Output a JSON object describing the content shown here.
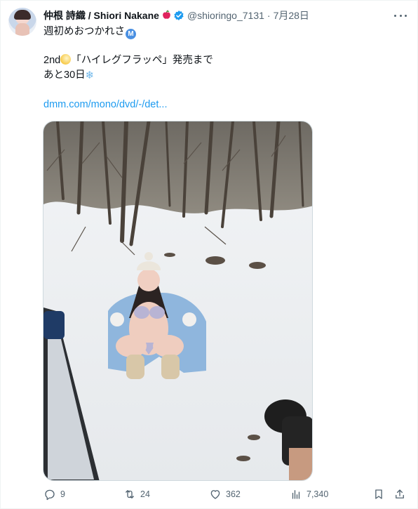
{
  "author": {
    "display_name": "仲根 詩織 / Shiori Nakane",
    "name_emoji_icon": "apple-icon",
    "verified_icon": "verified-badge-icon",
    "handle": "@shioringo_7131",
    "separator": "·",
    "date": "7月28日"
  },
  "tweet": {
    "line1": "週初めおつかれさ",
    "line2_prefix": "2nd",
    "line2_body": "「ハイレグフラッペ」発売まで",
    "line3": "あと30日",
    "link": "dmm.com/mono/dvd/-/det..."
  },
  "media": {
    "photo_icon": "photo-snow-scene"
  },
  "actions": {
    "replies": "9",
    "retweets": "24",
    "likes": "362",
    "views": "7,340"
  },
  "colors": {
    "link": "#1d9bf0",
    "secondary_text": "#536471",
    "verified": "#1d9bf0"
  }
}
